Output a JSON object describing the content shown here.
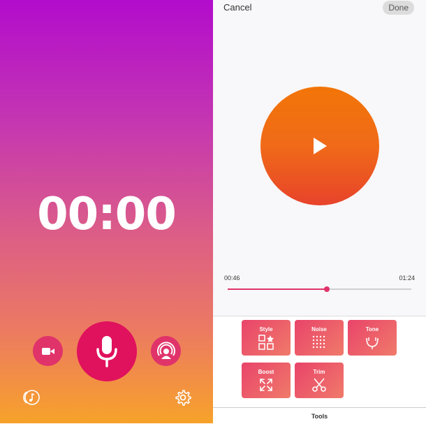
{
  "recorder": {
    "timer": "00:00",
    "icons": {
      "video": "video-camera-icon",
      "mic": "microphone-icon",
      "podcast": "podcast-icon",
      "music": "music-note-icon",
      "settings": "gear-icon"
    },
    "colors": {
      "accent": "#e0115d",
      "gradient_top": "#b20ccc",
      "gradient_bottom": "#f7a22a"
    }
  },
  "editor": {
    "cancel_label": "Cancel",
    "done_label": "Done",
    "play_icon": "play-icon",
    "current_time": "00:46",
    "total_time": "01:24",
    "progress": 0.54,
    "tools": [
      {
        "label": "Style",
        "icon": "style-grid-icon"
      },
      {
        "label": "Noise",
        "icon": "noise-dots-icon"
      },
      {
        "label": "Tone",
        "icon": "tone-icon"
      },
      {
        "label": "Boost",
        "icon": "expand-arrows-icon"
      },
      {
        "label": "Trim",
        "icon": "scissors-icon"
      }
    ],
    "tab_label": "Tools"
  }
}
